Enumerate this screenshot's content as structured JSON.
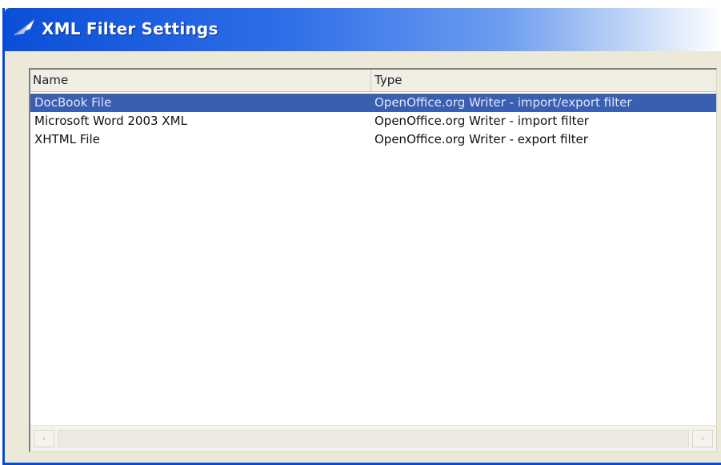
{
  "window": {
    "title": "XML Filter Settings",
    "icon": "openoffice-gull-icon"
  },
  "list": {
    "columns": [
      "Name",
      "Type"
    ],
    "rows": [
      {
        "name": "DocBook File",
        "type": "OpenOffice.org Writer - import/export filter",
        "selected": true
      },
      {
        "name": "Microsoft Word 2003 XML",
        "type": "OpenOffice.org Writer - import filter",
        "selected": false
      },
      {
        "name": "XHTML File",
        "type": "OpenOffice.org Writer - export filter",
        "selected": false
      }
    ]
  },
  "scrollbar": {
    "left_arrow": "‹",
    "right_arrow": "›"
  },
  "colors": {
    "title_bar": "#0a4fd8",
    "selection": "#3a5fb0",
    "dialog_bg": "#ece9d8"
  }
}
